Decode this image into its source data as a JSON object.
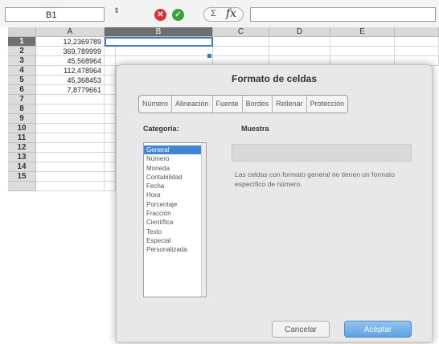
{
  "formula_bar": {
    "cell_reference": "B1",
    "stepper_symbol": "⇕",
    "cancel_symbol": "✕",
    "accept_symbol": "✓",
    "sum_symbol": "Σ",
    "fx_label": "fx",
    "formula_value": ""
  },
  "grid": {
    "columns": [
      "A",
      "B",
      "C",
      "D",
      "E"
    ],
    "selected_column": "B",
    "rows": [
      "1",
      "2",
      "3",
      "4",
      "5",
      "6",
      "7",
      "8",
      "9",
      "10",
      "11",
      "12",
      "13",
      "14",
      "15"
    ],
    "selected_row": "1",
    "active_cell": "B1",
    "column_a_values": [
      "12,2369789",
      "369,789999",
      "45,568964",
      "112,478964",
      "45,368453",
      "7,8779661"
    ]
  },
  "dialog": {
    "title": "Formato de celdas",
    "tabs": [
      "Número",
      "Alineación",
      "Fuente",
      "Bordes",
      "Rellenar",
      "Protección"
    ],
    "category_label": "Categoría:",
    "sample_label": "Muestra",
    "categories": [
      "General",
      "Número",
      "Moneda",
      "Contabilidad",
      "Fecha",
      "Hora",
      "Porcentaje",
      "Fracción",
      "Científica",
      "Texto",
      "Especial",
      "Personalizada"
    ],
    "selected_category": "General",
    "description": "Las celdas con formato general no tienen un formato específico de número.",
    "cancel_button": "Cancelar",
    "accept_button": "Aceptar"
  },
  "colors": {
    "selection_blue": "#3f86d8",
    "cancel_icon_red": "#d8322c",
    "accept_icon_green": "#3aa335",
    "accept_button_blue": "#5fa2e2"
  }
}
